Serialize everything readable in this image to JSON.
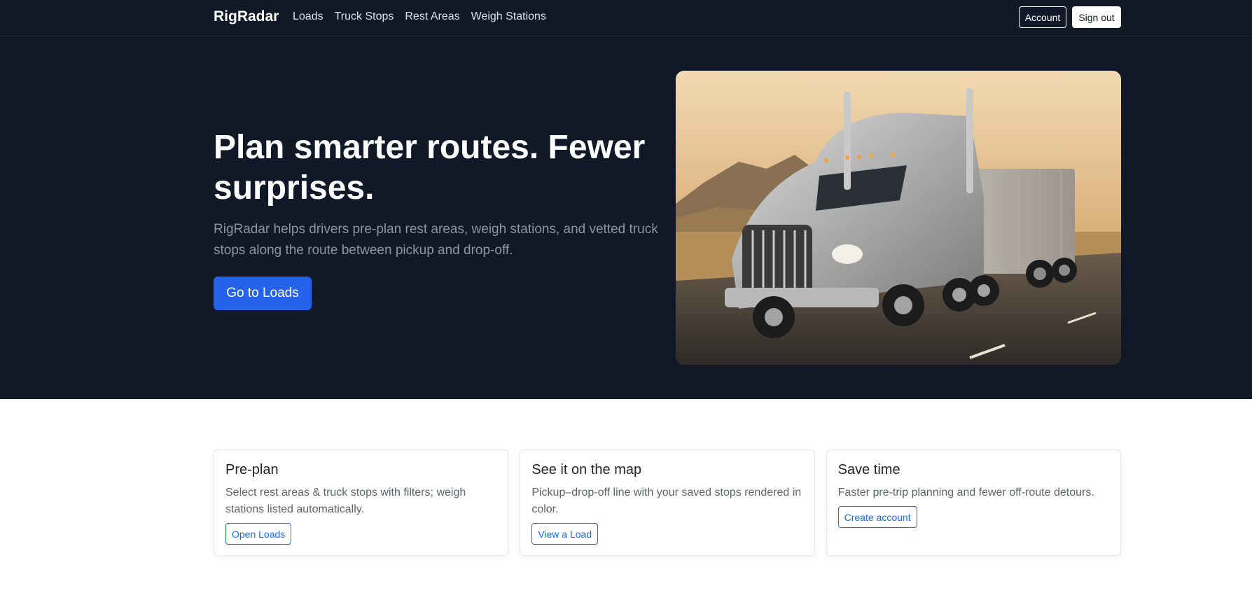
{
  "nav": {
    "brand": "RigRadar",
    "links": [
      "Loads",
      "Truck Stops",
      "Rest Areas",
      "Weigh Stations"
    ],
    "account_label": "Account",
    "signout_label": "Sign out"
  },
  "hero": {
    "title": "Plan smarter routes. Fewer surprises.",
    "subtitle": "RigRadar helps drivers pre-plan rest areas, weigh stations, and vetted truck stops along the route between pickup and drop-off.",
    "cta_label": "Go to Loads",
    "image_icon": "semi-truck-photo"
  },
  "features": [
    {
      "title": "Pre-plan",
      "text": "Select rest areas & truck stops with filters; weigh stations listed automatically.",
      "button": "Open Loads"
    },
    {
      "title": "See it on the map",
      "text": "Pickup–drop-off line with your saved stops rendered in color.",
      "button": "View a Load"
    },
    {
      "title": "Save time",
      "text": "Faster pre-trip planning and fewer off-route detours.",
      "button": "Create account"
    }
  ],
  "colors": {
    "dark_bg": "#111827",
    "primary": "#2563eb",
    "outline": "#0d6efd"
  }
}
